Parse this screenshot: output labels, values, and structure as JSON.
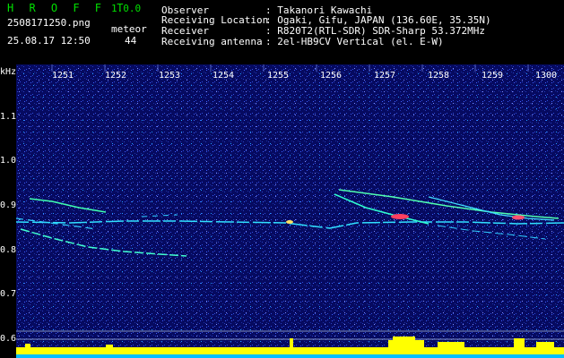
{
  "header": {
    "app_name": "H R O F F T",
    "version": "1.0.0",
    "filename": "2508171250.png",
    "datetime": "25.08.17 12:50",
    "count_label": "meteor",
    "count_value": "44",
    "fields": [
      {
        "label": "Observer",
        "value": ": Takanori Kawachi"
      },
      {
        "label": "Receiving Location",
        "value": ": Ogaki, Gifu, JAPAN (136.60E, 35.35N)"
      },
      {
        "label": "Receiver",
        "value": ": R820T2(RTL-SDR) SDR-Sharp 53.372MHz"
      },
      {
        "label": "Receiving antenna",
        "value": ": 2el-HB9CV Vertical (el. E-W)"
      }
    ]
  },
  "axes": {
    "y_unit": "kHz",
    "y_ticks": [
      "1.1",
      "1.0",
      "0.9",
      "0.8",
      "0.7",
      "0.6"
    ],
    "x_ticks": [
      "1251",
      "1252",
      "1253",
      "1254",
      "1255",
      "1256",
      "1257",
      "1258",
      "1259",
      "1300"
    ]
  },
  "colors": {
    "background": "#060a60",
    "text_header": "#00e000",
    "text_axis": "#ffffff",
    "signal": "#00ffff",
    "strong_signal": "#ff4040",
    "baseline": "#ffff00"
  }
}
